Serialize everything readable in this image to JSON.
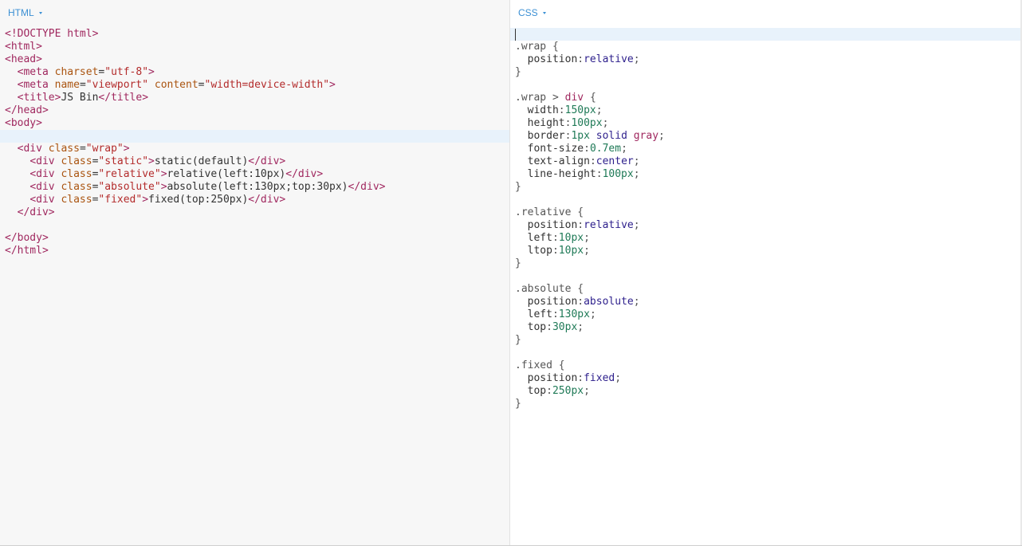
{
  "html_panel": {
    "label": "HTML",
    "active_line": 8,
    "lines": [
      [
        [
          "tag",
          "<!DOCTYPE html>"
        ]
      ],
      [
        [
          "tag",
          "<html>"
        ]
      ],
      [
        [
          "tag",
          "<head>"
        ]
      ],
      [
        [
          "plain",
          "  "
        ],
        [
          "tag",
          "<meta "
        ],
        [
          "attr",
          "charset"
        ],
        [
          "plain",
          "="
        ],
        [
          "str",
          "\"utf-8\""
        ],
        [
          "tag",
          ">"
        ]
      ],
      [
        [
          "plain",
          "  "
        ],
        [
          "tag",
          "<meta "
        ],
        [
          "attr",
          "name"
        ],
        [
          "plain",
          "="
        ],
        [
          "str",
          "\"viewport\""
        ],
        [
          "plain",
          " "
        ],
        [
          "attr",
          "content"
        ],
        [
          "plain",
          "="
        ],
        [
          "str",
          "\"width=device-width\""
        ],
        [
          "tag",
          ">"
        ]
      ],
      [
        [
          "plain",
          "  "
        ],
        [
          "tag",
          "<title>"
        ],
        [
          "txt",
          "JS Bin"
        ],
        [
          "tag",
          "</title>"
        ]
      ],
      [
        [
          "tag",
          "</head>"
        ]
      ],
      [
        [
          "tag",
          "<body>"
        ]
      ],
      [],
      [
        [
          "plain",
          "  "
        ],
        [
          "tag",
          "<div "
        ],
        [
          "attr",
          "class"
        ],
        [
          "plain",
          "="
        ],
        [
          "str",
          "\"wrap\""
        ],
        [
          "tag",
          ">"
        ]
      ],
      [
        [
          "plain",
          "    "
        ],
        [
          "tag",
          "<div "
        ],
        [
          "attr",
          "class"
        ],
        [
          "plain",
          "="
        ],
        [
          "str",
          "\"static\""
        ],
        [
          "tag",
          ">"
        ],
        [
          "txt",
          "static(default)"
        ],
        [
          "tag",
          "</div>"
        ]
      ],
      [
        [
          "plain",
          "    "
        ],
        [
          "tag",
          "<div "
        ],
        [
          "attr",
          "class"
        ],
        [
          "plain",
          "="
        ],
        [
          "str",
          "\"relative\""
        ],
        [
          "tag",
          ">"
        ],
        [
          "txt",
          "relative(left:10px)"
        ],
        [
          "tag",
          "</div>"
        ]
      ],
      [
        [
          "plain",
          "    "
        ],
        [
          "tag",
          "<div "
        ],
        [
          "attr",
          "class"
        ],
        [
          "plain",
          "="
        ],
        [
          "str",
          "\"absolute\""
        ],
        [
          "tag",
          ">"
        ],
        [
          "txt",
          "absolute(left:130px;top:30px)"
        ],
        [
          "tag",
          "</div>"
        ]
      ],
      [
        [
          "plain",
          "    "
        ],
        [
          "tag",
          "<div "
        ],
        [
          "attr",
          "class"
        ],
        [
          "plain",
          "="
        ],
        [
          "str",
          "\"fixed\""
        ],
        [
          "tag",
          ">"
        ],
        [
          "txt",
          "fixed(top:250px)"
        ],
        [
          "tag",
          "</div>"
        ]
      ],
      [
        [
          "plain",
          "  "
        ],
        [
          "tag",
          "</div>"
        ]
      ],
      [],
      [
        [
          "tag",
          "</body>"
        ]
      ],
      [
        [
          "tag",
          "</html>"
        ]
      ]
    ]
  },
  "css_panel": {
    "label": "CSS",
    "active_line": 0,
    "lines": [
      [],
      [
        [
          "sel",
          ".wrap "
        ],
        [
          "punc",
          "{"
        ]
      ],
      [
        [
          "plain",
          "  "
        ],
        [
          "prop",
          "position"
        ],
        [
          "punc",
          ":"
        ],
        [
          "kw",
          "relative"
        ],
        [
          "punc",
          ";"
        ]
      ],
      [
        [
          "punc",
          "}"
        ]
      ],
      [],
      [
        [
          "sel",
          ".wrap > "
        ],
        [
          "tag",
          "div"
        ],
        [
          "plain",
          " "
        ],
        [
          "punc",
          "{"
        ]
      ],
      [
        [
          "plain",
          "  "
        ],
        [
          "prop",
          "width"
        ],
        [
          "punc",
          ":"
        ],
        [
          "num",
          "150px"
        ],
        [
          "punc",
          ";"
        ]
      ],
      [
        [
          "plain",
          "  "
        ],
        [
          "prop",
          "height"
        ],
        [
          "punc",
          ":"
        ],
        [
          "num",
          "100px"
        ],
        [
          "punc",
          ";"
        ]
      ],
      [
        [
          "plain",
          "  "
        ],
        [
          "prop",
          "border"
        ],
        [
          "punc",
          ":"
        ],
        [
          "num",
          "1px"
        ],
        [
          "plain",
          " "
        ],
        [
          "kw",
          "solid"
        ],
        [
          "plain",
          " "
        ],
        [
          "tag",
          "gray"
        ],
        [
          "punc",
          ";"
        ]
      ],
      [
        [
          "plain",
          "  "
        ],
        [
          "prop",
          "font-size"
        ],
        [
          "punc",
          ":"
        ],
        [
          "num",
          "0.7em"
        ],
        [
          "punc",
          ";"
        ]
      ],
      [
        [
          "plain",
          "  "
        ],
        [
          "prop",
          "text-align"
        ],
        [
          "punc",
          ":"
        ],
        [
          "kw",
          "center"
        ],
        [
          "punc",
          ";"
        ]
      ],
      [
        [
          "plain",
          "  "
        ],
        [
          "prop",
          "line-height"
        ],
        [
          "punc",
          ":"
        ],
        [
          "num",
          "100px"
        ],
        [
          "punc",
          ";"
        ]
      ],
      [
        [
          "punc",
          "}"
        ]
      ],
      [],
      [
        [
          "sel",
          ".relative "
        ],
        [
          "punc",
          "{"
        ]
      ],
      [
        [
          "plain",
          "  "
        ],
        [
          "prop",
          "position"
        ],
        [
          "punc",
          ":"
        ],
        [
          "kw",
          "relative"
        ],
        [
          "punc",
          ";"
        ]
      ],
      [
        [
          "plain",
          "  "
        ],
        [
          "prop",
          "left"
        ],
        [
          "punc",
          ":"
        ],
        [
          "num",
          "10px"
        ],
        [
          "punc",
          ";"
        ]
      ],
      [
        [
          "plain",
          "  "
        ],
        [
          "prop",
          "ltop"
        ],
        [
          "punc",
          ":"
        ],
        [
          "num",
          "10px"
        ],
        [
          "punc",
          ";"
        ]
      ],
      [
        [
          "punc",
          "}"
        ]
      ],
      [],
      [
        [
          "sel",
          ".absolute "
        ],
        [
          "punc",
          "{"
        ]
      ],
      [
        [
          "plain",
          "  "
        ],
        [
          "prop",
          "position"
        ],
        [
          "punc",
          ":"
        ],
        [
          "kw",
          "absolute"
        ],
        [
          "punc",
          ";"
        ]
      ],
      [
        [
          "plain",
          "  "
        ],
        [
          "prop",
          "left"
        ],
        [
          "punc",
          ":"
        ],
        [
          "num",
          "130px"
        ],
        [
          "punc",
          ";"
        ]
      ],
      [
        [
          "plain",
          "  "
        ],
        [
          "prop",
          "top"
        ],
        [
          "punc",
          ":"
        ],
        [
          "num",
          "30px"
        ],
        [
          "punc",
          ";"
        ]
      ],
      [
        [
          "punc",
          "}"
        ]
      ],
      [],
      [
        [
          "sel",
          ".fixed "
        ],
        [
          "punc",
          "{"
        ]
      ],
      [
        [
          "plain",
          "  "
        ],
        [
          "prop",
          "position"
        ],
        [
          "punc",
          ":"
        ],
        [
          "kw",
          "fixed"
        ],
        [
          "punc",
          ";"
        ]
      ],
      [
        [
          "plain",
          "  "
        ],
        [
          "prop",
          "top"
        ],
        [
          "punc",
          ":"
        ],
        [
          "num",
          "250px"
        ],
        [
          "punc",
          ";"
        ]
      ],
      [
        [
          "punc",
          "}"
        ]
      ]
    ]
  },
  "colors": {
    "label_blue": "#3c90d4",
    "active_line_bg": "#e8f2fb",
    "html_panel_bg": "#f7f7f7",
    "css_panel_bg": "#ffffff"
  }
}
